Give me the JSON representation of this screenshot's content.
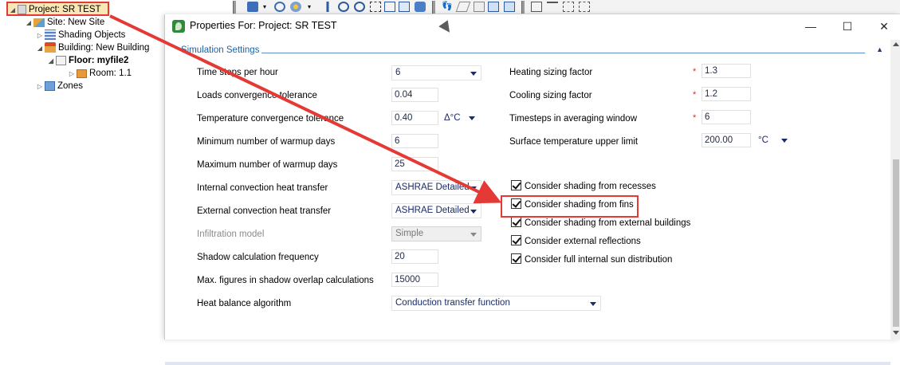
{
  "tree": {
    "project": "Project: SR TEST",
    "site": "Site: New Site",
    "shading": "Shading Objects",
    "building": "Building: New Building",
    "floor": "Floor: myfile2",
    "room": "Room: 1.1",
    "zones": "Zones"
  },
  "dialog": {
    "title": "Properties For: Project: SR TEST",
    "minimize": "—",
    "maximize": "☐",
    "close": "✕",
    "section_title": "Simulation Settings",
    "section_collapse": "▲"
  },
  "settings_left": [
    {
      "label": "Time steps per hour",
      "value": "6",
      "kind": "combo"
    },
    {
      "label": "Loads convergence tolerance",
      "value": "0.04",
      "kind": "field"
    },
    {
      "label": "Temperature convergence tolerance",
      "value": "0.40",
      "kind": "field",
      "unit": "Δ°C"
    },
    {
      "label": "Minimum number of warmup days",
      "value": "6",
      "kind": "field"
    },
    {
      "label": "Maximum number of warmup days",
      "value": "25",
      "kind": "field"
    },
    {
      "label": "Internal convection heat transfer",
      "value": "ASHRAE Detailed",
      "kind": "combo"
    },
    {
      "label": "External convection heat transfer",
      "value": "ASHRAE Detailed",
      "kind": "combo"
    },
    {
      "label": "Infiltration model",
      "value": "Simple",
      "kind": "combo",
      "disabled": true
    },
    {
      "label": "Shadow calculation frequency",
      "value": "20",
      "kind": "field"
    },
    {
      "label": "Max. figures in shadow overlap calculations",
      "value": "15000",
      "kind": "field"
    },
    {
      "label": "Heat balance algorithm",
      "value": "Conduction transfer function",
      "kind": "combo"
    }
  ],
  "settings_right": [
    {
      "label": "Heating sizing factor",
      "value": "1.3",
      "required": "*"
    },
    {
      "label": "Cooling sizing factor",
      "value": "1.2",
      "required": "*"
    },
    {
      "label": "Timesteps in averaging window",
      "value": "6",
      "required": "*"
    },
    {
      "label": "Surface temperature upper limit",
      "value": "200.00",
      "unit": "°C"
    }
  ],
  "checkboxes": [
    {
      "label": "Consider shading from recesses",
      "checked": true
    },
    {
      "label": "Consider shading from fins",
      "checked": true
    },
    {
      "label": "Consider shading from external buildings",
      "checked": true
    },
    {
      "label": "Consider external reflections",
      "checked": true
    },
    {
      "label": "Consider full internal sun distribution",
      "checked": true
    }
  ],
  "colors": {
    "highlight": "#e53935",
    "section_text": "#1e63a8",
    "value_text": "#1a2b66"
  }
}
